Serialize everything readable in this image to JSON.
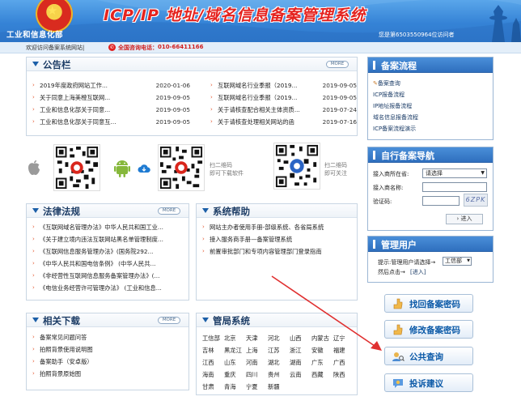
{
  "header": {
    "ministry": "工业和信息化部",
    "site_title": "ICP/IP 地址/域名信息备案管理系统",
    "visitor_count": "您是第6503550964位访问者"
  },
  "strip": {
    "welcome": "欢迎访问备案系统网站|",
    "hotline_label": "全国咨询电话：",
    "hotline_number": "010-66411166"
  },
  "notice": {
    "title": "公告栏",
    "more": "MORE",
    "left_items": [
      {
        "text": "2019年度政府网站工作...",
        "date": "2020-01-06"
      },
      {
        "text": "关于同意上海美橙互联网...",
        "date": "2019-09-05"
      },
      {
        "text": "工业和信息化部关于同意...",
        "date": "2019-09-05"
      },
      {
        "text": "工业和信息化部关于同意互...",
        "date": "2019-09-05"
      }
    ],
    "right_items": [
      {
        "text": "互联网域名行业季报（2019...",
        "date": "2019-09-05"
      },
      {
        "text": "互联网域名行业季报（2019...",
        "date": "2019-09-05"
      },
      {
        "text": "关于请核查配合相关主体资质...",
        "date": "2019-07-24"
      },
      {
        "text": "关于请核查处理相关网站的函",
        "date": "2019-07-16"
      }
    ]
  },
  "apps": {
    "android_download": "下载",
    "qr2_caption_line1": "扫二维码",
    "qr2_caption_line2": "即可下载软件",
    "qr3_caption_line1": "扫二维码",
    "qr3_caption_line2": "即可关注"
  },
  "laws": {
    "title": "法律法规",
    "more": "MORE",
    "items": [
      "《互联网域名管理办法》中华人民共和国工业...",
      "《关于建立境内违法互联网站黑名单管理制度...",
      "《互联网信息服务管理办法》(国务院292...",
      "《中华人民共和国电信条例》 (中华人民共...",
      "《非经营性互联网信息服务备案管理办法》(...",
      "《电信业务经营许可管理办法》 (工业和信息..."
    ]
  },
  "help": {
    "title": "系统帮助",
    "items": [
      "网站主办者使用手册-部级系统、各省局系统",
      "接入服务商手册—备案管理系统",
      "前置审批部门和专项内容管理部门登录指南"
    ]
  },
  "downloads": {
    "title": "相关下载",
    "more": "MORE",
    "items": [
      "备案常见问题问答",
      "拍照背景使用说明图",
      "备案助手（安卓版）",
      "拍照背景原始图"
    ]
  },
  "bureaus": {
    "title": "管局系统",
    "cities": [
      "工信部",
      "北京",
      "天津",
      "河北",
      "山西",
      "内蒙古",
      "辽宁",
      "吉林",
      "黑龙江",
      "上海",
      "江苏",
      "浙江",
      "安徽",
      "福建",
      "江西",
      "山东",
      "河南",
      "湖北",
      "湖南",
      "广东",
      "广西",
      "海南",
      "重庆",
      "四川",
      "贵州",
      "云南",
      "西藏",
      "陕西",
      "甘肃",
      "青海",
      "宁夏",
      "新疆"
    ]
  },
  "flow": {
    "title": "备案流程",
    "items": [
      "备案查询",
      "ICP报备流程",
      "IP地址报备流程",
      "域名信息报备流程",
      "ICP备案流程演示"
    ]
  },
  "self_nav": {
    "title": "自行备案导航",
    "province_label": "接入商所在省:",
    "province_value": "请选择",
    "name_label": "接入商名称:",
    "name_value": "",
    "captcha_label": "验证码:",
    "captcha_value": "",
    "captcha_image": "6ZPK",
    "enter": "进入"
  },
  "admin": {
    "title": "管理用户",
    "hint_prefix": "提示:管理用户请选择→",
    "role_value": "工信部",
    "hint_suffix": "然后点击→",
    "enter_link": "[进入]"
  },
  "actions": {
    "find_password": "找回备案密码",
    "change_password": "修改备案密码",
    "public_query": "公共查询",
    "complaint": "投诉建议"
  },
  "colors": {
    "header_blue": "#3583d6",
    "title_red": "#e5231f",
    "accent_orange": "#e4572e",
    "annotation_red": "#e03030"
  }
}
